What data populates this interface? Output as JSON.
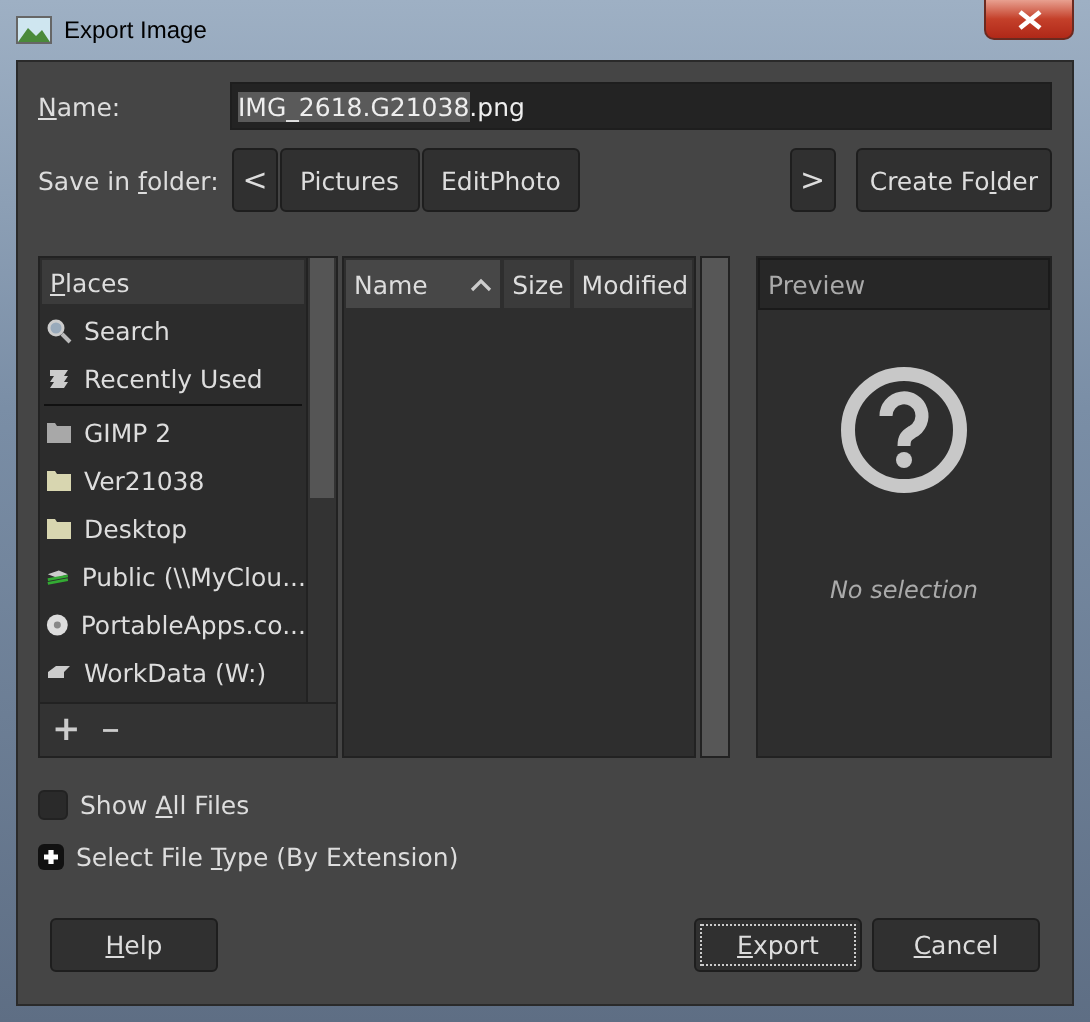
{
  "window": {
    "title": "Export Image"
  },
  "name_field": {
    "label": {
      "key": "N",
      "post": "ame:"
    },
    "value_selected": "IMG_2618.G21038",
    "value_rest": ".png"
  },
  "folder_row": {
    "label": {
      "pre": "Save in ",
      "key": "f",
      "post": "older:"
    },
    "back": "<",
    "crumbs": [
      {
        "label": "Pictures",
        "selected": false
      },
      {
        "label": "EditPhoto",
        "selected": false
      }
    ],
    "forward": ">",
    "create": {
      "pre": "Create Fo",
      "key": "l",
      "post": "der"
    }
  },
  "places": {
    "header": {
      "key": "P",
      "post": "laces"
    },
    "sections": [
      {
        "items": [
          {
            "label": "Search",
            "kind": "search"
          },
          {
            "label": "Recently Used",
            "kind": "recent"
          }
        ]
      },
      {
        "items": [
          {
            "label": "GIMP 2",
            "kind": "folder-gray"
          },
          {
            "label": "Ver21038",
            "kind": "folder"
          },
          {
            "label": "Desktop",
            "kind": "folder"
          },
          {
            "label": "Public (\\\\MyClou...",
            "kind": "network"
          },
          {
            "label": "PortableApps.co...",
            "kind": "disc"
          },
          {
            "label": "WorkData (W:)",
            "kind": "drive"
          }
        ]
      }
    ],
    "add": "+",
    "remove": "−"
  },
  "files": {
    "columns": [
      {
        "label": "Name",
        "sorted": true
      },
      {
        "label": "Size",
        "sorted": false
      },
      {
        "label": "Modified",
        "sorted": false
      }
    ]
  },
  "preview": {
    "header": "Preview",
    "message": "No selection"
  },
  "options": [
    {
      "kind": "checkbox",
      "checked": false,
      "label": {
        "pre": "Show ",
        "key": "A",
        "post": "ll Files"
      }
    },
    {
      "kind": "expander",
      "expanded": false,
      "label": {
        "pre": "Select File ",
        "key": "T",
        "post": "ype (By Extension)"
      }
    }
  ],
  "buttons_left": [
    {
      "label": {
        "key": "H",
        "post": "elp"
      },
      "default": false
    }
  ],
  "buttons_right": [
    {
      "label": {
        "key": "E",
        "post": "xport"
      },
      "default": true
    },
    {
      "label": {
        "key": "C",
        "post": "ancel"
      },
      "default": false
    }
  ]
}
